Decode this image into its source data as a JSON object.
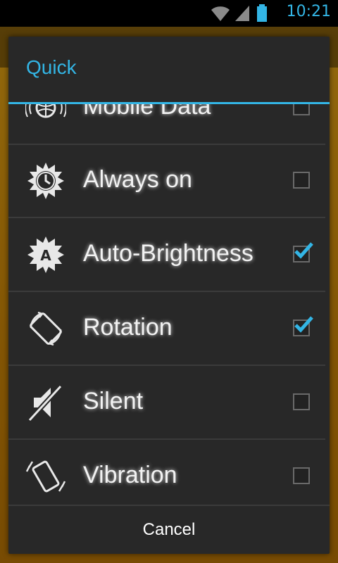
{
  "status": {
    "time": "10:21"
  },
  "dialog": {
    "title": "Quick",
    "items": [
      {
        "label": "Mobile Data",
        "checked": false,
        "icon": "globe-signal-icon"
      },
      {
        "label": "Always on",
        "checked": false,
        "icon": "sun-clock-icon"
      },
      {
        "label": "Auto-Brightness",
        "checked": true,
        "icon": "auto-brightness-icon"
      },
      {
        "label": "Rotation",
        "checked": true,
        "icon": "rotation-icon"
      },
      {
        "label": "Silent",
        "checked": false,
        "icon": "speaker-muted-icon"
      },
      {
        "label": "Vibration",
        "checked": false,
        "icon": "vibration-icon"
      }
    ],
    "cancel_label": "Cancel"
  },
  "colors": {
    "accent": "#33b5e5",
    "dialog_bg": "#282828"
  }
}
